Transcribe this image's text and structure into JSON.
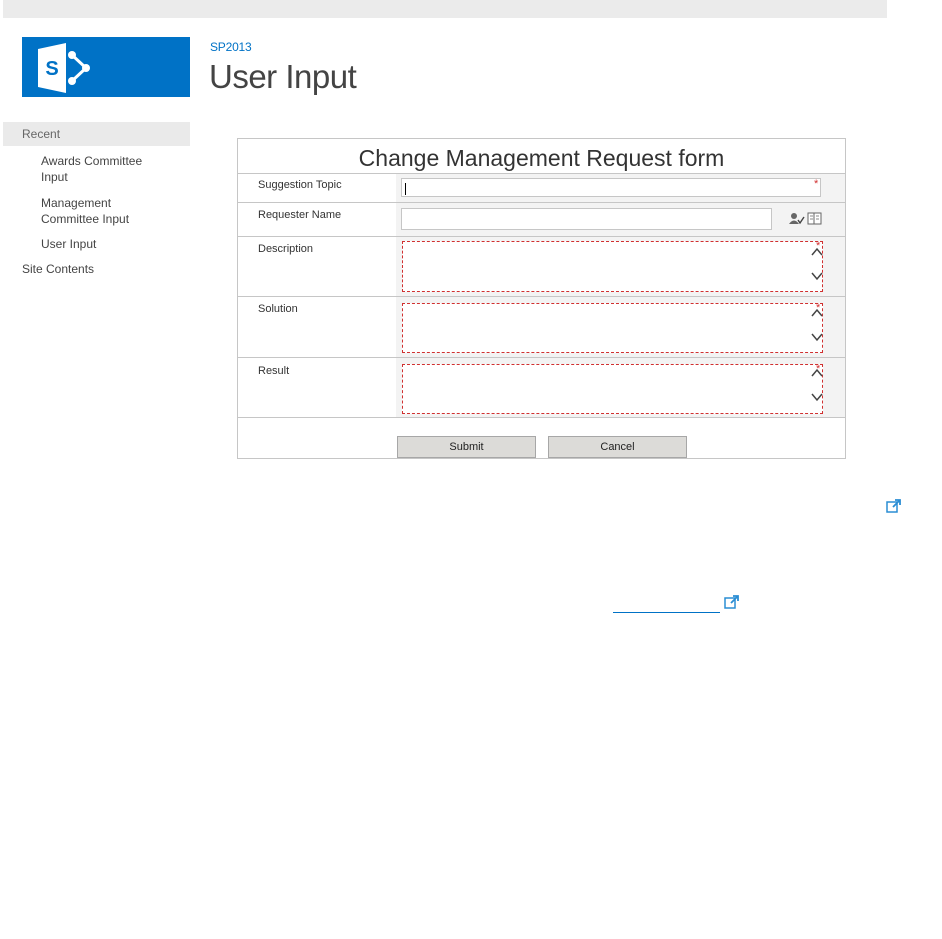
{
  "site": {
    "link_label": "SP2013",
    "page_title": "User Input",
    "brand_color": "#0072c6"
  },
  "quick_launch": {
    "heading": "Recent",
    "items": [
      {
        "label": "Awards Committee Input"
      },
      {
        "label": "Management Committee Input"
      },
      {
        "label": "User Input"
      }
    ],
    "site_contents": "Site Contents"
  },
  "form": {
    "title": "Change Management Request form",
    "fields": [
      {
        "label": "Suggestion Topic",
        "value": "",
        "required": true
      },
      {
        "label": "Requester Name",
        "value": "",
        "required": false
      },
      {
        "label": "Description",
        "value": "",
        "required": true
      },
      {
        "label": "Solution",
        "value": "",
        "required": true
      },
      {
        "label": "Result",
        "value": "",
        "required": true
      }
    ],
    "required_mark": "*",
    "submit_label": "Submit",
    "cancel_label": "Cancel"
  },
  "icons": {
    "check_names": "check-names-icon",
    "browse_people": "address-book-icon",
    "open_external": "open-in-new-window-icon",
    "scroll_up": "chevron-up-icon",
    "scroll_down": "chevron-down-icon"
  },
  "footer": {
    "link_text": ""
  }
}
